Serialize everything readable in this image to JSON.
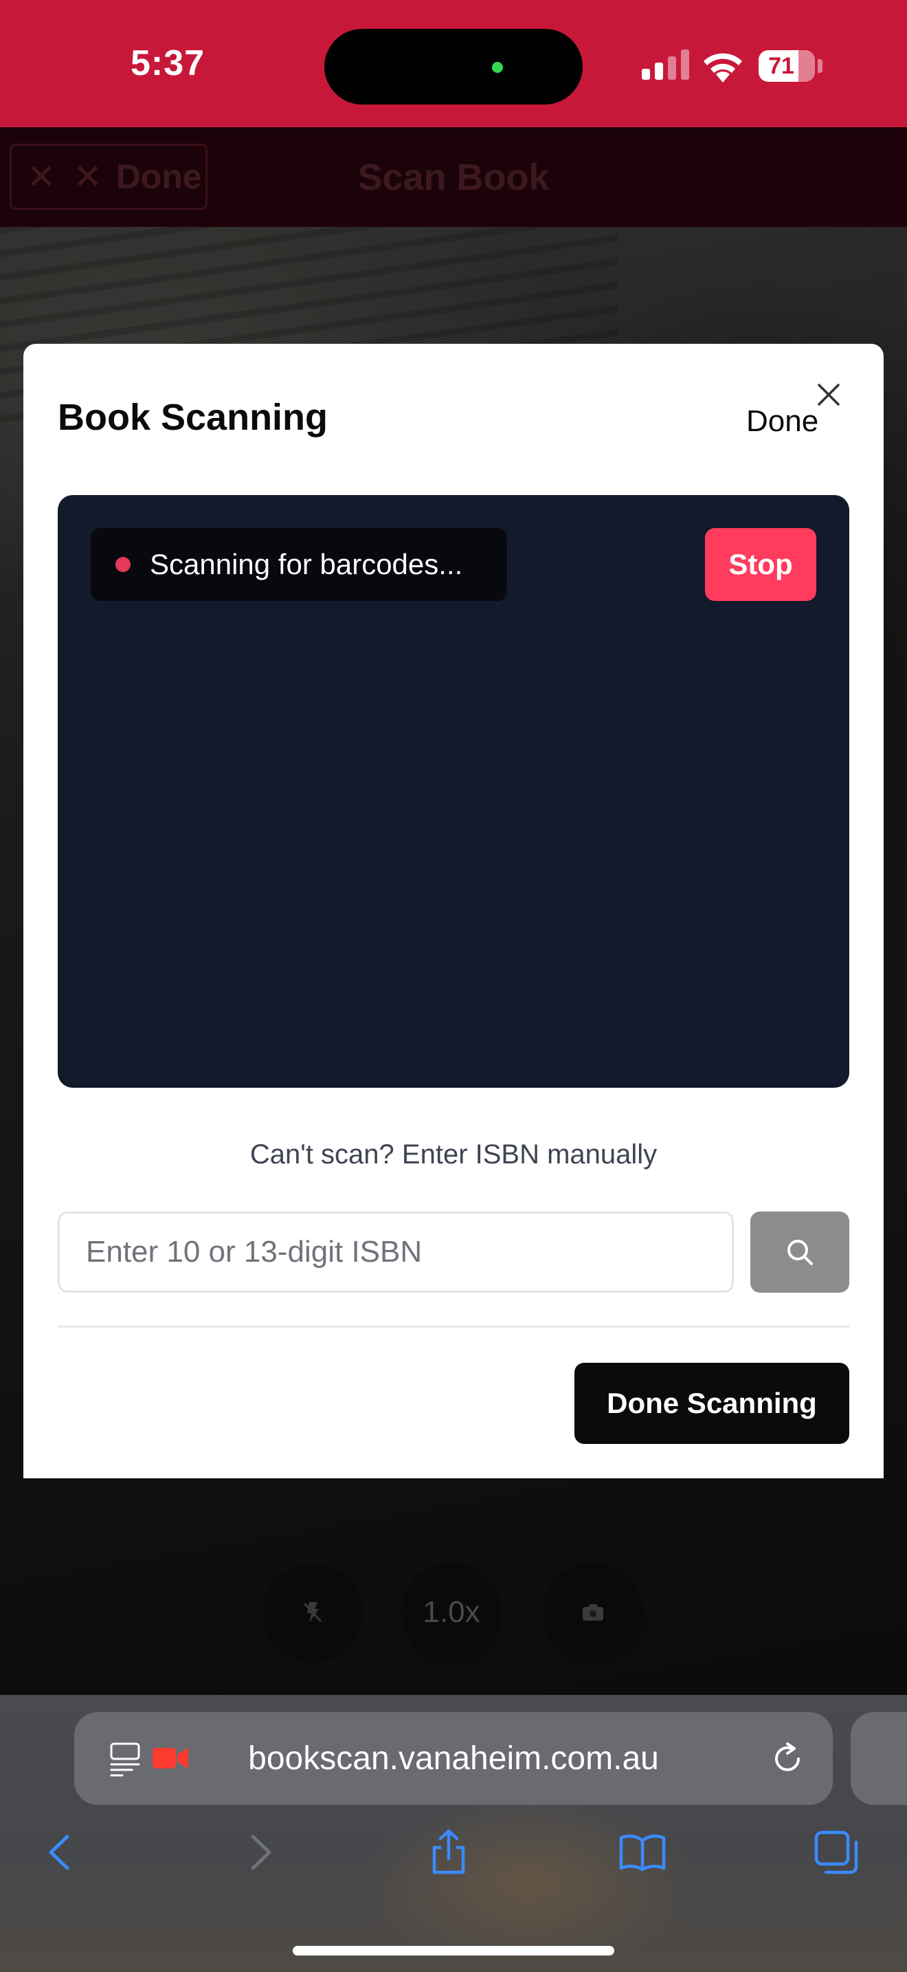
{
  "status_bar": {
    "time": "5:37",
    "battery_percent": "71",
    "battery_level": 0.71,
    "signal_bars": 2
  },
  "underlying_page": {
    "header_title": "Scan Book",
    "done_label": "Done",
    "done_icons": "✕ ✕",
    "zoom_label": "1.0x",
    "header_bg": "#2c0610"
  },
  "modal": {
    "title": "Book Scanning",
    "done_label": "Done",
    "scanner": {
      "status_text": "Scanning for barcodes...",
      "stop_label": "Stop"
    },
    "manual_entry_label": "Can't scan? Enter ISBN manually",
    "isbn_input": {
      "value": "",
      "placeholder": "Enter 10 or 13-digit ISBN"
    },
    "done_scanning_label": "Done Scanning"
  },
  "browser": {
    "url": "bookscan.vanaheim.com.au",
    "icons": [
      "reader-icon",
      "camera-indicator-icon",
      "reload-icon",
      "back-icon",
      "forward-icon",
      "share-icon",
      "bookmarks-icon",
      "tabs-icon"
    ]
  },
  "colors": {
    "status_bar": "#c8183a",
    "stop_button": "#ff3b5e",
    "scanner_bg": "#131a2b",
    "recording_dot": "#e33a5a",
    "accent_blue": "#3b8bff"
  }
}
